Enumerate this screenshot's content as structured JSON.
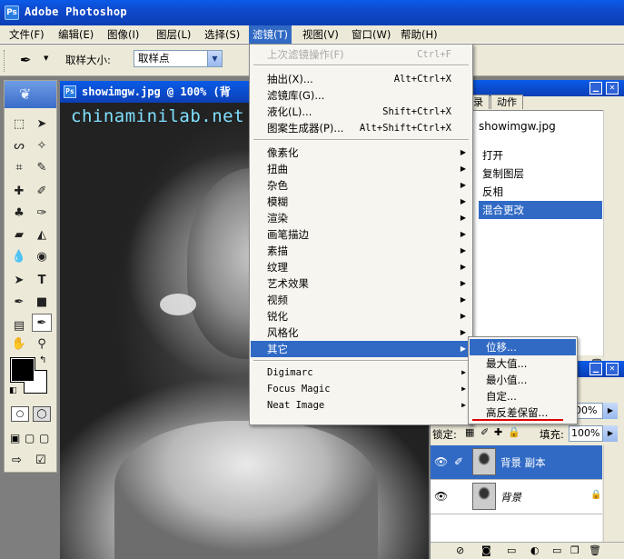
{
  "app": {
    "title": "Adobe Photoshop"
  },
  "menubar": [
    {
      "label": "文件(F)"
    },
    {
      "label": "编辑(E)"
    },
    {
      "label": "图像(I)"
    },
    {
      "label": "图层(L)"
    },
    {
      "label": "选择(S)"
    },
    {
      "label": "滤镜(T)"
    },
    {
      "label": "视图(V)"
    },
    {
      "label": "窗口(W)"
    },
    {
      "label": "帮助(H)"
    }
  ],
  "options": {
    "sample_size_label": "取样大小:",
    "sample_size_value": "取样点"
  },
  "document": {
    "title": "showimgw.jpg @ 100% (背",
    "watermark": "chinaminilab.net"
  },
  "filter_menu": {
    "last_filter": {
      "label": "上次滤镜操作(F)",
      "shortcut": "Ctrl+F"
    },
    "group1": [
      {
        "label": "抽出(X)...",
        "shortcut": "Alt+Ctrl+X"
      },
      {
        "label": "滤镜库(G)...",
        "shortcut": ""
      },
      {
        "label": "液化(L)...",
        "shortcut": "Shift+Ctrl+X"
      },
      {
        "label": "图案生成器(P)...",
        "shortcut": "Alt+Shift+Ctrl+X"
      }
    ],
    "group2": [
      {
        "label": "像素化"
      },
      {
        "label": "扭曲"
      },
      {
        "label": "杂色"
      },
      {
        "label": "模糊"
      },
      {
        "label": "渲染"
      },
      {
        "label": "画笔描边"
      },
      {
        "label": "素描"
      },
      {
        "label": "纹理"
      },
      {
        "label": "艺术效果"
      },
      {
        "label": "视频"
      },
      {
        "label": "锐化"
      },
      {
        "label": "风格化"
      },
      {
        "label": "其它"
      }
    ],
    "group3": [
      {
        "label": "Digimarc"
      },
      {
        "label": "Focus Magic"
      },
      {
        "label": "Neat Image"
      }
    ]
  },
  "other_submenu": [
    {
      "label": "位移..."
    },
    {
      "label": "最大值..."
    },
    {
      "label": "最小值..."
    },
    {
      "label": "自定..."
    },
    {
      "label": "高反差保留..."
    }
  ],
  "history_panel": {
    "tabs": [
      {
        "label": "录"
      },
      {
        "label": "动作"
      }
    ],
    "snapshot": "showimgw.jpg",
    "items": [
      {
        "label": "打开"
      },
      {
        "label": "复制图层"
      },
      {
        "label": "反相"
      },
      {
        "label": "混合更改"
      }
    ]
  },
  "layers_panel": {
    "opacity": "00%",
    "lock_label": "锁定:",
    "fill_label": "填充:",
    "fill_value": "100%",
    "layers": [
      {
        "name": "背景 副本"
      },
      {
        "name": "背景"
      }
    ]
  }
}
